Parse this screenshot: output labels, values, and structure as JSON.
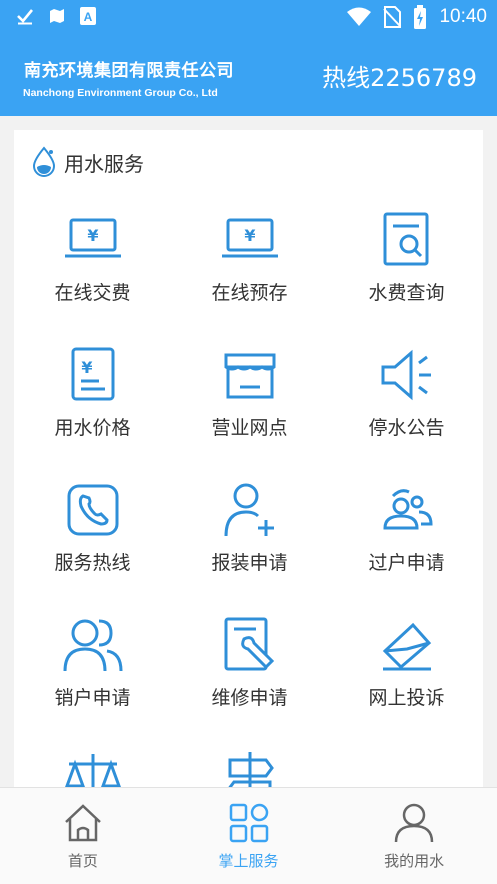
{
  "status_bar": {
    "time": "10:40",
    "icons": [
      "check-icon",
      "map-icon",
      "font-a-icon",
      "wifi-icon",
      "no-sim-icon",
      "battery-charging-icon"
    ]
  },
  "header": {
    "company_name": "南充环境集团有限责任公司",
    "company_name_en": "Nanchong Environment Group Co., Ltd",
    "hotline": "热线2256789"
  },
  "section": {
    "title": "用水服务",
    "icon": "water-drop-icon"
  },
  "services": [
    {
      "label": "在线交费",
      "icon": "laptop-yen-icon"
    },
    {
      "label": "在线预存",
      "icon": "laptop-yen-icon"
    },
    {
      "label": "水费查询",
      "icon": "document-search-icon"
    },
    {
      "label": "用水价格",
      "icon": "price-sheet-icon"
    },
    {
      "label": "营业网点",
      "icon": "storefront-icon"
    },
    {
      "label": "停水公告",
      "icon": "speaker-icon"
    },
    {
      "label": "服务热线",
      "icon": "phone-icon"
    },
    {
      "label": "报装申请",
      "icon": "add-user-icon"
    },
    {
      "label": "过户申请",
      "icon": "user-group-icon"
    },
    {
      "label": "销户申请",
      "icon": "two-users-icon"
    },
    {
      "label": "维修申请",
      "icon": "repair-document-icon"
    },
    {
      "label": "网上投诉",
      "icon": "envelope-icon"
    },
    {
      "label": "",
      "icon": "scales-icon"
    },
    {
      "label": "",
      "icon": "signpost-icon"
    }
  ],
  "tabs": [
    {
      "label": "首页",
      "icon": "home-icon",
      "active": false
    },
    {
      "label": "掌上服务",
      "icon": "grid-icon",
      "active": true
    },
    {
      "label": "我的用水",
      "icon": "user-icon",
      "active": false
    }
  ],
  "colors": {
    "primary": "#3aa3f3",
    "icon_blue": "#2f8fd8",
    "text": "#333333",
    "tab_inactive": "#666666"
  }
}
